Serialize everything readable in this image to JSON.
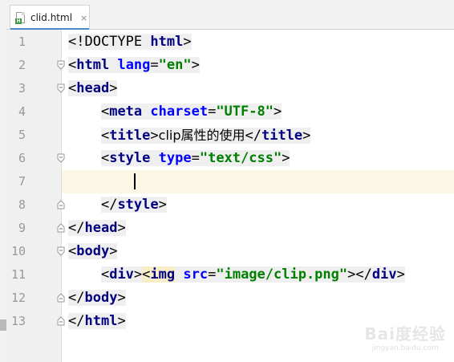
{
  "tab": {
    "filename": "clid.html",
    "close_glyph": "×",
    "file_badge": "H"
  },
  "watermark": {
    "brand": "Bai度经验",
    "url": "jingyan.baidu.com"
  },
  "colors": {
    "tag": "#000080",
    "attr": "#0000ff",
    "value": "#008000",
    "current_line": "#fcf6e5",
    "tab_accent": "#4a88c7"
  },
  "editor": {
    "current_line": 7,
    "lines": [
      {
        "num": "1",
        "tokens": {
          "open": "<!DOCTYPE ",
          "name": "html",
          "close": ">"
        }
      },
      {
        "num": "2",
        "tokens": {
          "open": "<",
          "name": "html",
          "sp": " ",
          "attr": "lang",
          "eq": "=",
          "val": "\"en\"",
          "close": ">"
        }
      },
      {
        "num": "3",
        "tokens": {
          "open": "<",
          "name": "head",
          "close": ">"
        }
      },
      {
        "num": "4",
        "tokens": {
          "indent": "    ",
          "open": "<",
          "name": "meta",
          "sp": " ",
          "attr": "charset",
          "eq": "=",
          "val": "\"UTF-8\"",
          "close": ">"
        }
      },
      {
        "num": "5",
        "tokens": {
          "indent": "    ",
          "open": "<",
          "name": "title",
          "close": ">",
          "text": "clip属性的使用",
          "open2": "</",
          "name2": "title",
          "close2": ">"
        }
      },
      {
        "num": "6",
        "tokens": {
          "indent": "    ",
          "open": "<",
          "name": "style",
          "sp": " ",
          "attr": "type",
          "eq": "=",
          "val": "\"text/css\"",
          "close": ">"
        }
      },
      {
        "num": "7",
        "tokens": {
          "indent": "        "
        }
      },
      {
        "num": "8",
        "tokens": {
          "indent": "    ",
          "open": "</",
          "name": "style",
          "close": ">"
        }
      },
      {
        "num": "9",
        "tokens": {
          "open": "</",
          "name": "head",
          "close": ">"
        }
      },
      {
        "num": "10",
        "tokens": {
          "open": "<",
          "name": "body",
          "close": ">"
        }
      },
      {
        "num": "11",
        "tokens": {
          "indent": "    ",
          "open": "<",
          "name": "div",
          "close": ">",
          "open2": "<",
          "name2": "img",
          "sp": " ",
          "attr": "src",
          "eq": "=",
          "val": "\"image/clip.png\"",
          "close2": ">",
          "open3": "</",
          "name3": "div",
          "close3": ">"
        }
      },
      {
        "num": "12",
        "tokens": {
          "open": "</",
          "name": "body",
          "close": ">"
        }
      },
      {
        "num": "13",
        "tokens": {
          "open": "</",
          "name": "html",
          "close": ">"
        }
      }
    ]
  }
}
